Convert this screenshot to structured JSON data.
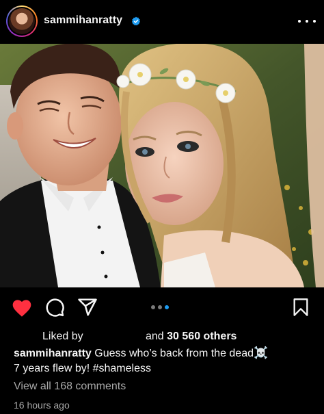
{
  "header": {
    "username": "sammihanratty",
    "verified": true,
    "more_icon": "more-horizontal-icon"
  },
  "post": {
    "carousel": {
      "count": 3,
      "active_index": 2,
      "active_color": "#1d9bf0"
    },
    "actions": {
      "like_icon": "heart-filled-icon",
      "like_color": "#ff3040",
      "comment_icon": "comment-bubble-icon",
      "share_icon": "paper-plane-icon",
      "save_icon": "bookmark-icon"
    }
  },
  "likes": {
    "prefix": "Liked by",
    "middle": "and",
    "count": "30 560 others"
  },
  "caption": {
    "username": "sammihanratty",
    "line1": "Guess who’s back from the dead",
    "emoji": "☠️",
    "line2": "7 years flew by! #shameless"
  },
  "comments": {
    "view_all": "View all 168 comments"
  },
  "timestamp": "16 hours ago"
}
